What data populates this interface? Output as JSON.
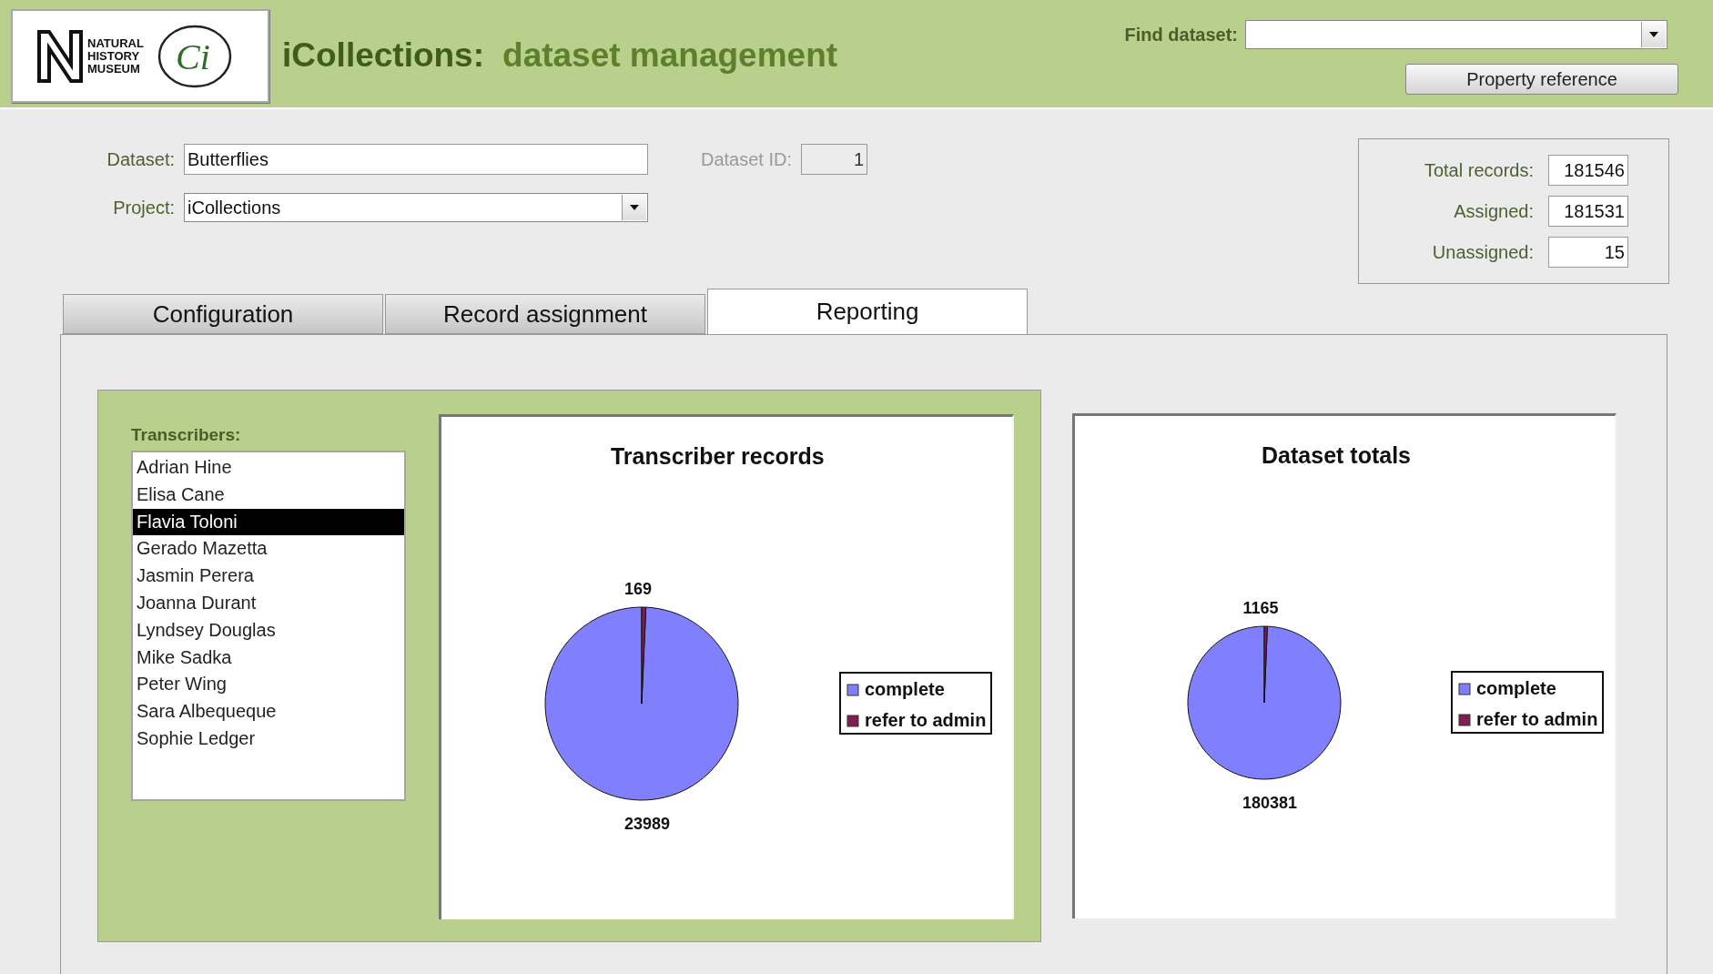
{
  "header": {
    "logo_lines": [
      "NATURAL",
      "HISTORY",
      "MUSEUM"
    ],
    "emblem": "Ci",
    "title_app": "iCollections:",
    "title_section": "dataset management",
    "find_label": "Find dataset:",
    "property_button": "Property reference"
  },
  "form": {
    "dataset_label": "Dataset:",
    "dataset_value": "Butterflies",
    "project_label": "Project:",
    "project_value": "iCollections",
    "dataset_id_label": "Dataset ID:",
    "dataset_id_value": "1"
  },
  "totals": [
    {
      "label": "Total records:",
      "value": "181546"
    },
    {
      "label": "Assigned:",
      "value": "181531"
    },
    {
      "label": "Unassigned:",
      "value": "15"
    }
  ],
  "tabs": [
    {
      "label": "Configuration",
      "selected": false
    },
    {
      "label": "Record assignment",
      "selected": false
    },
    {
      "label": "Reporting",
      "selected": true
    }
  ],
  "reporting": {
    "transcribers_label": "Transcribers:",
    "transcribers": [
      {
        "name": "Adrian Hine",
        "selected": false
      },
      {
        "name": "Elisa Cane",
        "selected": false
      },
      {
        "name": "Flavia Toloni",
        "selected": true
      },
      {
        "name": "Gerado Mazetta",
        "selected": false
      },
      {
        "name": "Jasmin Perera",
        "selected": false
      },
      {
        "name": "Joanna Durant",
        "selected": false
      },
      {
        "name": "Lyndsey Douglas",
        "selected": false
      },
      {
        "name": "Mike Sadka",
        "selected": false
      },
      {
        "name": "Peter Wing",
        "selected": false
      },
      {
        "name": "Sara Albequeque",
        "selected": false
      },
      {
        "name": "Sophie Ledger",
        "selected": false
      }
    ],
    "charts": [
      {
        "chart_data": {
          "type": "pie",
          "title": "Transcriber records",
          "categories": [
            "complete",
            "refer to admin"
          ],
          "values": [
            23989,
            169
          ],
          "colors": [
            "#8080ff",
            "#7f1f4f"
          ],
          "data_labels": true,
          "legend": "right"
        }
      },
      {
        "chart_data": {
          "type": "pie",
          "title": "Dataset totals",
          "categories": [
            "complete",
            "refer to admin"
          ],
          "values": [
            180381,
            1165
          ],
          "colors": [
            "#8080ff",
            "#7f1f4f"
          ],
          "data_labels": true,
          "legend": "right"
        }
      }
    ]
  }
}
